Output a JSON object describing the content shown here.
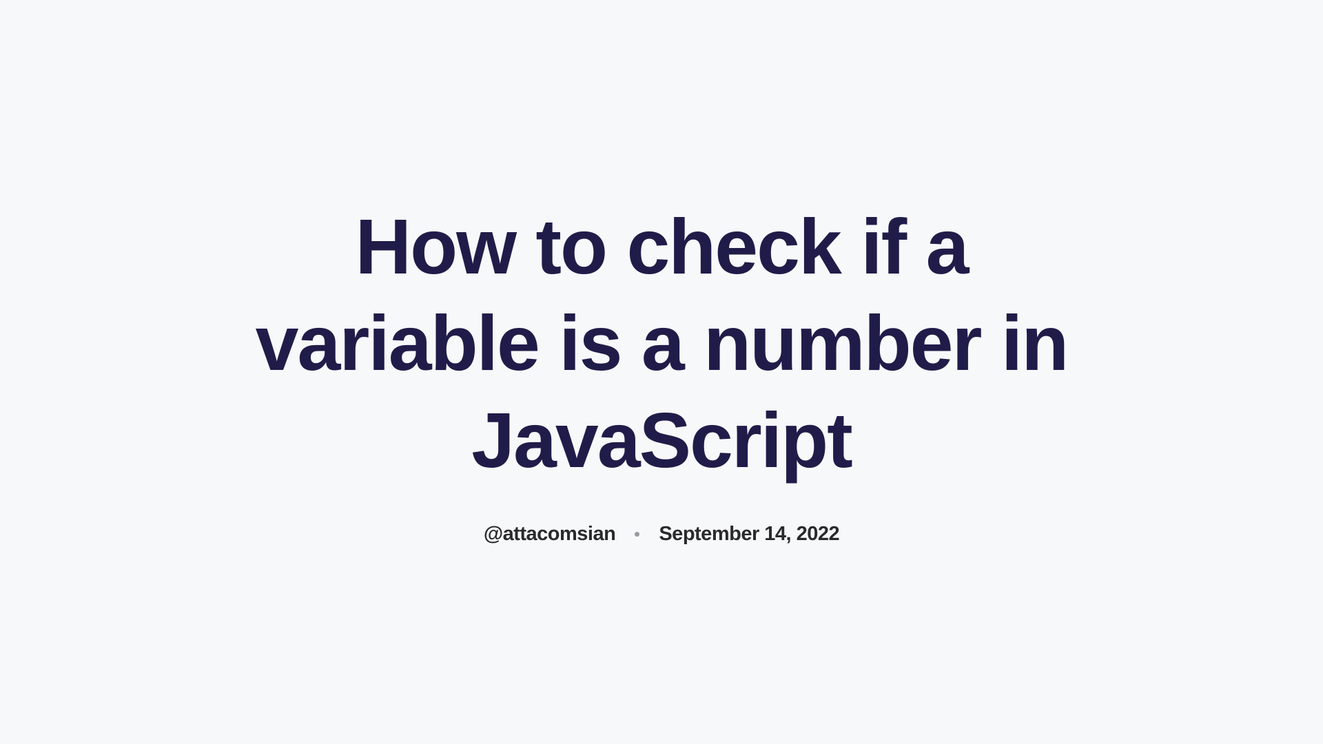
{
  "article": {
    "title": "How to check if a variable is a number in JavaScript",
    "author": "@attacomsian",
    "date": "September 14, 2022"
  }
}
